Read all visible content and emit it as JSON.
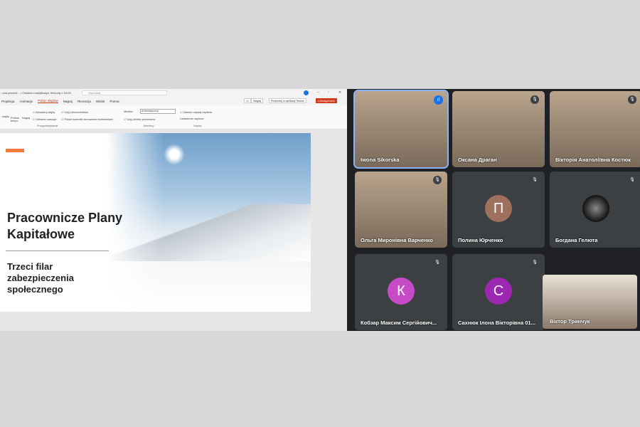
{
  "app": {
    "doc_title": "...ona prezent... • Ostatnio modyfikacja: Wczoraj o 16:00",
    "search_placeholder": "Wyszukaj"
  },
  "tabs": [
    "Projekcja",
    "Animacje",
    "Pokaz slajdów",
    "Nagraj",
    "Recenzja",
    "Widok",
    "Pomoc"
  ],
  "active_tab": "Pokaz slajdów",
  "toolbar": {
    "record": "Nagraj",
    "present_teams": "Prezentuj w aplikacji Teams",
    "share": "Udostępnianie"
  },
  "ribbon": {
    "from_current": "...slajdu",
    "rehearse": "Próbne tempo",
    "record": "Nagraj",
    "update_slides": "Aktualizuj slajdy",
    "use_timings": "Użyj chronometrażu",
    "play_narrations": "Odtwórz narracje",
    "show_media_controls": "Pokaż kontrolki sterowania multimediami",
    "group_setup": "Przygotowywanie",
    "monitor_label": "Monitor:",
    "monitor_value": "Automatyczny",
    "presenter_view": "Użyj widoku prezentera",
    "group_monitors": "Monitory",
    "always_captions": "Zawsze używaj napisów",
    "caption_settings": "Ustawienia napisów",
    "group_captions": "Napisy"
  },
  "slide": {
    "title": "Pracownicze Plany Kapitałowe",
    "subtitle": "Trzeci filar zabezpieczenia społecznego"
  },
  "participants": [
    {
      "name": "Iwona Sikorska",
      "type": "video",
      "speaking": true
    },
    {
      "name": "Оксана Драган",
      "type": "video",
      "muted": true
    },
    {
      "name": "Вікторія Анатоліївна Костюк",
      "type": "video",
      "muted": true
    },
    {
      "name": "Ольга Миронівна Варченко",
      "type": "video",
      "muted": true
    },
    {
      "name": "Полина Юрченко",
      "type": "avatar",
      "initial": "П",
      "color": "#a0705f",
      "muted": true
    },
    {
      "name": "Богдана Гелюта",
      "type": "photo",
      "muted": true
    },
    {
      "name": "Кобзар Максим Сергійович...",
      "type": "avatar",
      "initial": "К",
      "color": "#c74bc7",
      "muted": true
    },
    {
      "name": "Сахнюк Ілона Вікторівна 01...",
      "type": "avatar",
      "initial": "С",
      "color": "#9c27b0",
      "muted": true
    }
  ],
  "self_view": {
    "name": "Віктор Тринчук"
  }
}
